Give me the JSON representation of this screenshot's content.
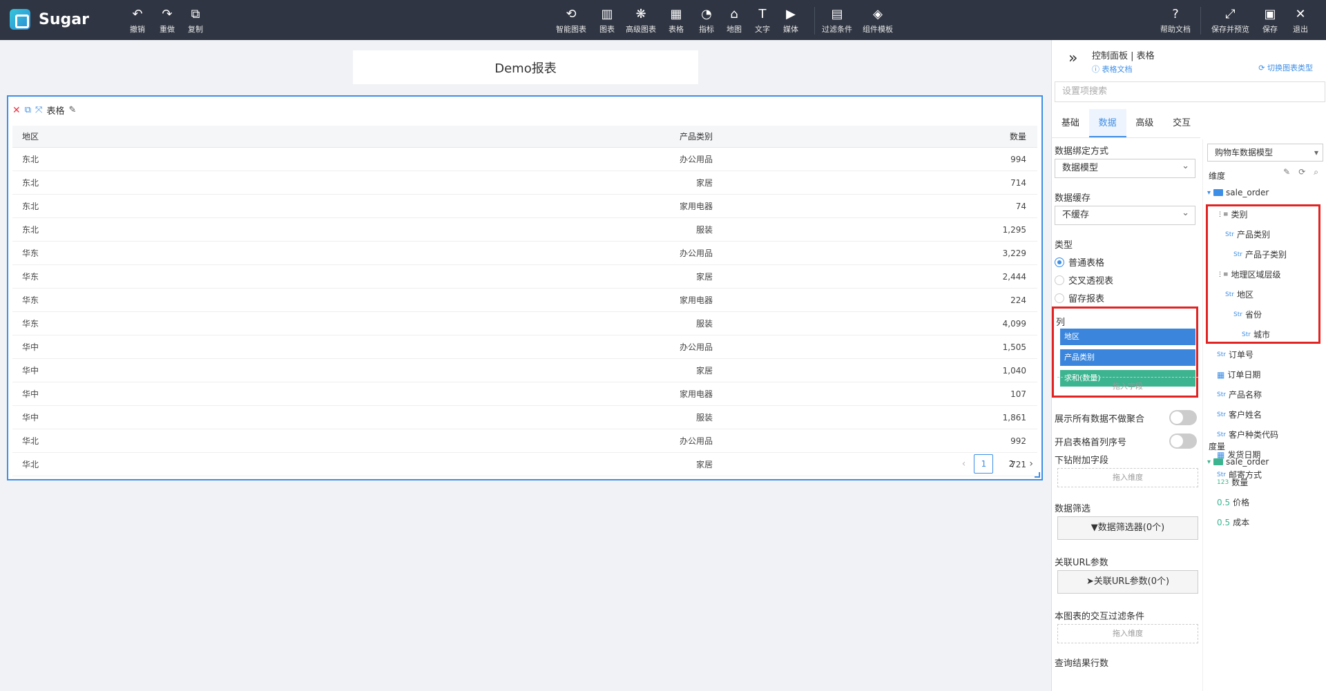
{
  "app": {
    "name": "Sugar"
  },
  "toolbar": {
    "left": [
      {
        "icon": "undo-icon",
        "glyph": "↶",
        "label": "撤销"
      },
      {
        "icon": "redo-icon",
        "glyph": "↷",
        "label": "重做"
      },
      {
        "icon": "copy-icon",
        "glyph": "⧉",
        "label": "复制"
      }
    ],
    "center": [
      {
        "icon": "smart-chart-icon",
        "glyph": "⟲",
        "label": "智能图表"
      },
      {
        "icon": "bar-chart-icon",
        "glyph": "▥",
        "label": "图表"
      },
      {
        "icon": "advanced-chart-icon",
        "glyph": "❋",
        "label": "高级图表"
      },
      {
        "icon": "table-icon",
        "glyph": "▦",
        "label": "表格"
      },
      {
        "icon": "gauge-icon",
        "glyph": "◔",
        "label": "指标"
      },
      {
        "icon": "map-icon",
        "glyph": "⌂",
        "label": "地图"
      },
      {
        "icon": "text-icon",
        "glyph": "T",
        "label": "文字"
      },
      {
        "icon": "media-icon",
        "glyph": "▶",
        "label": "媒体"
      }
    ],
    "center2": [
      {
        "icon": "filter-icon",
        "glyph": "▤",
        "label": "过滤条件"
      },
      {
        "icon": "template-icon",
        "glyph": "◈",
        "label": "组件模板"
      }
    ],
    "right": [
      {
        "icon": "help-icon",
        "glyph": "?",
        "label": "帮助文档"
      },
      {
        "icon": "save-preview-icon",
        "glyph": "⤢",
        "label": "保存并预览"
      },
      {
        "icon": "save-icon",
        "glyph": "▣",
        "label": "保存"
      },
      {
        "icon": "exit-icon",
        "glyph": "✕",
        "label": "退出"
      }
    ]
  },
  "report": {
    "title": "Demo报表"
  },
  "widget": {
    "name": "表格",
    "columns": [
      "地区",
      "产品类别",
      "数量"
    ],
    "rows": [
      [
        "东北",
        "办公用品",
        "994"
      ],
      [
        "东北",
        "家居",
        "714"
      ],
      [
        "东北",
        "家用电器",
        "74"
      ],
      [
        "东北",
        "服装",
        "1,295"
      ],
      [
        "华东",
        "办公用品",
        "3,229"
      ],
      [
        "华东",
        "家居",
        "2,444"
      ],
      [
        "华东",
        "家用电器",
        "224"
      ],
      [
        "华东",
        "服装",
        "4,099"
      ],
      [
        "华中",
        "办公用品",
        "1,505"
      ],
      [
        "华中",
        "家居",
        "1,040"
      ],
      [
        "华中",
        "家用电器",
        "107"
      ],
      [
        "华中",
        "服装",
        "1,861"
      ],
      [
        "华北",
        "办公用品",
        "992"
      ],
      [
        "华北",
        "家居",
        "721"
      ]
    ],
    "pager": {
      "pages": [
        "1",
        "2"
      ],
      "current": "1"
    }
  },
  "panel": {
    "title": "控制面板 | 表格",
    "doc_link": "表格文档",
    "switch_link": "切换图表类型",
    "search_placeholder": "设置项搜索",
    "tabs": [
      "基础",
      "数据",
      "高级",
      "交互"
    ],
    "active_tab": "数据",
    "binding_label": "数据绑定方式",
    "binding_value": "数据模型",
    "cache_label": "数据缓存",
    "cache_value": "不缓存",
    "type_label": "类型",
    "types": [
      "普通表格",
      "交叉透视表",
      "留存报表"
    ],
    "columns_label": "列",
    "column_fields": [
      {
        "label": "地区",
        "color": "#3b86dc"
      },
      {
        "label": "产品类别",
        "color": "#3b86dc"
      },
      {
        "label": "求和(数量)",
        "color": "#3bb48f"
      }
    ],
    "drop_field": "拖入字段",
    "show_all_label": "展示所有数据不做聚合",
    "row_number_label": "开启表格首列序号",
    "drill_label": "下钻附加字段",
    "drop_dimension": "拖入维度",
    "filter_label": "数据筛选",
    "filter_button": "数据筛选器(0个)",
    "url_label": "关联URL参数",
    "url_button": "关联URL参数(0个)",
    "interact_label": "本图表的交互过滤条件",
    "drop_dimension2": "拖入维度",
    "cut_label": "查询结果行数"
  },
  "model": {
    "selected": "购物车数据模型",
    "dimension_label": "维度",
    "table_name": "sale_order",
    "dimensions": [
      {
        "type": "hier",
        "label": "类别",
        "indent": 1
      },
      {
        "type": "Str",
        "label": "产品类别",
        "indent": 2
      },
      {
        "type": "Str",
        "label": "产品子类别",
        "indent": 3
      },
      {
        "type": "hier",
        "label": "地理区域层级",
        "indent": 1
      },
      {
        "type": "Str",
        "label": "地区",
        "indent": 2
      },
      {
        "type": "Str",
        "label": "省份",
        "indent": 3
      },
      {
        "type": "Str",
        "label": "城市",
        "indent": 4
      },
      {
        "type": "Str",
        "label": "订单号",
        "indent": 1
      },
      {
        "type": "Date",
        "label": "订单日期",
        "indent": 1
      },
      {
        "type": "Str",
        "label": "产品名称",
        "indent": 1
      },
      {
        "type": "Str",
        "label": "客户姓名",
        "indent": 1
      },
      {
        "type": "Str",
        "label": "客户种类代码",
        "indent": 1
      },
      {
        "type": "Date",
        "label": "发货日期",
        "indent": 1
      },
      {
        "type": "Str",
        "label": "邮寄方式",
        "indent": 1
      }
    ],
    "measure_label": "度量",
    "measure_table": "sale_order",
    "measures": [
      {
        "type": "123",
        "label": "数量"
      },
      {
        "type": "0.5",
        "label": "价格"
      },
      {
        "type": "0.5",
        "label": "成本"
      }
    ]
  }
}
